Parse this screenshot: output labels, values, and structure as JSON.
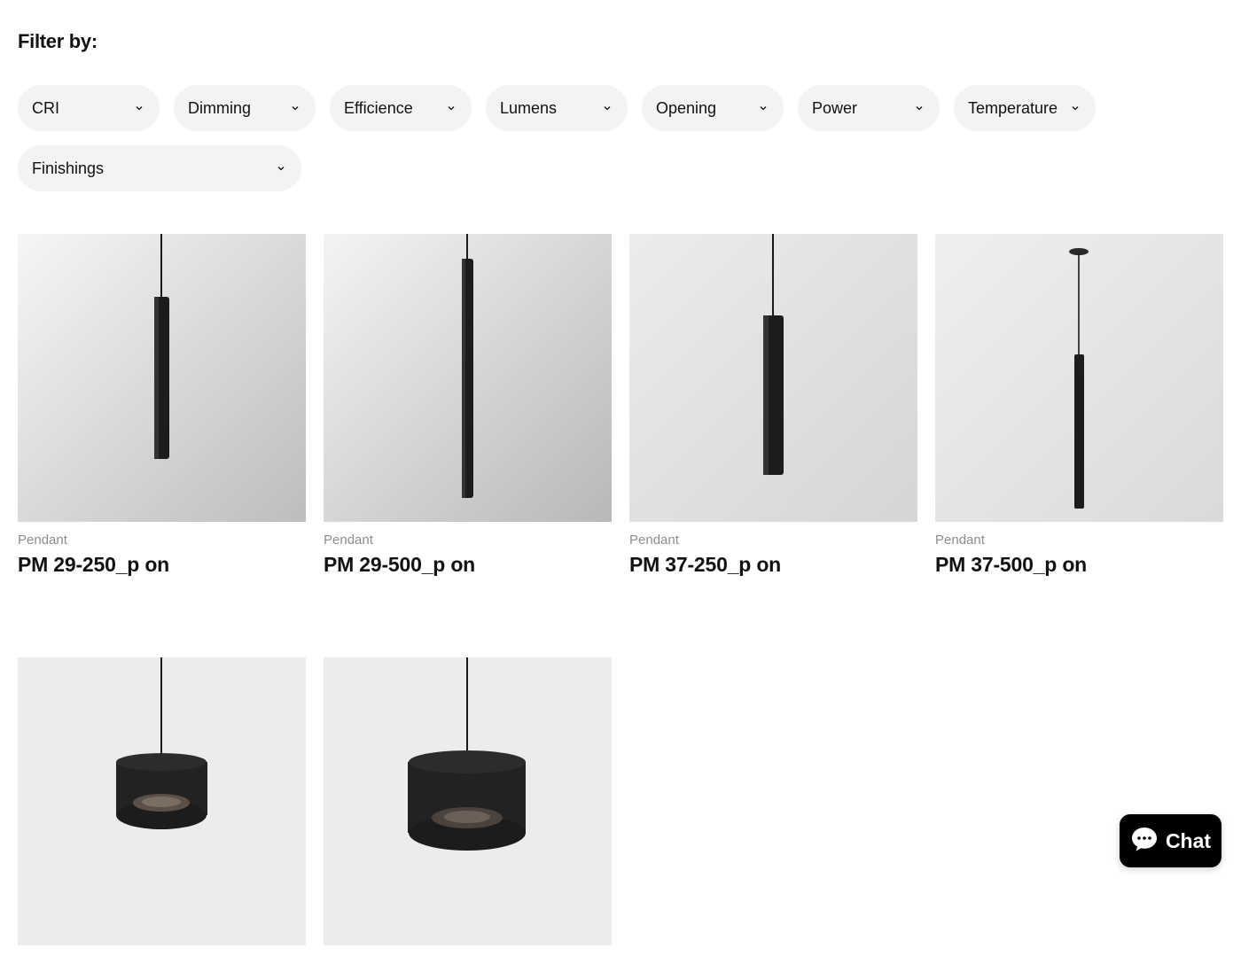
{
  "filter_heading": "Filter by:",
  "filters": [
    "CRI",
    "Dimming",
    "Efficience",
    "Lumens",
    "Opening",
    "Power",
    "Temperature",
    "Finishings"
  ],
  "products": [
    {
      "category": "Pendant",
      "name": "PM 29-250_p on",
      "image": "tall-slim-pendant-lamp"
    },
    {
      "category": "Pendant",
      "name": "PM 29-500_p on",
      "image": "extra-tall-slim-pendant-lamp"
    },
    {
      "category": "Pendant",
      "name": "PM 37-250_p on",
      "image": "wide-tube-pendant-lamp"
    },
    {
      "category": "Pendant",
      "name": "PM 37-500_p on",
      "image": "long-tube-pendant-with-canopy"
    },
    {
      "category": "",
      "name": "",
      "image": "small-drum-pendant-lamp"
    },
    {
      "category": "",
      "name": "",
      "image": "large-drum-pendant-lamp"
    }
  ],
  "chat": {
    "label": "Chat",
    "icon": "chat-bubble-icon"
  },
  "colors": {
    "pill_bg": "#f3f3f3",
    "text": "#111111",
    "muted": "#8c8c8c",
    "chat_bg": "#000000"
  }
}
